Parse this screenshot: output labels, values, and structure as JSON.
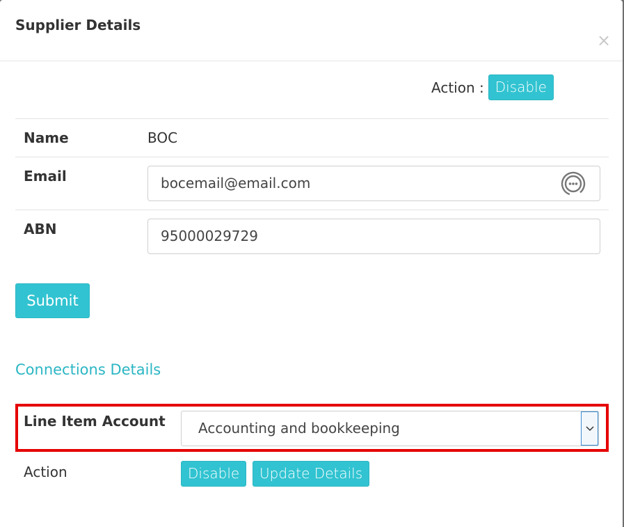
{
  "modal": {
    "title": "Supplier Details",
    "close_symbol": "×"
  },
  "top_action": {
    "label": "Action :",
    "button_label": "Disable"
  },
  "fields": {
    "name": {
      "label": "Name",
      "value": "BOC"
    },
    "email": {
      "label": "Email",
      "value": "bocemail@email.com",
      "icon": "more-options-circle-icon"
    },
    "abn": {
      "label": "ABN",
      "value": "95000029729"
    }
  },
  "submit_label": "Submit",
  "connections": {
    "title": "Connections Details",
    "line_item_account": {
      "label": "Line Item Account",
      "selected": "Accounting and bookkeeping"
    },
    "action": {
      "label": "Action",
      "disable_label": "Disable",
      "update_label": "Update Details"
    }
  },
  "colors": {
    "accent": "#31c3d1",
    "section_title": "#2bb6c4",
    "highlight_border": "#e50000"
  }
}
